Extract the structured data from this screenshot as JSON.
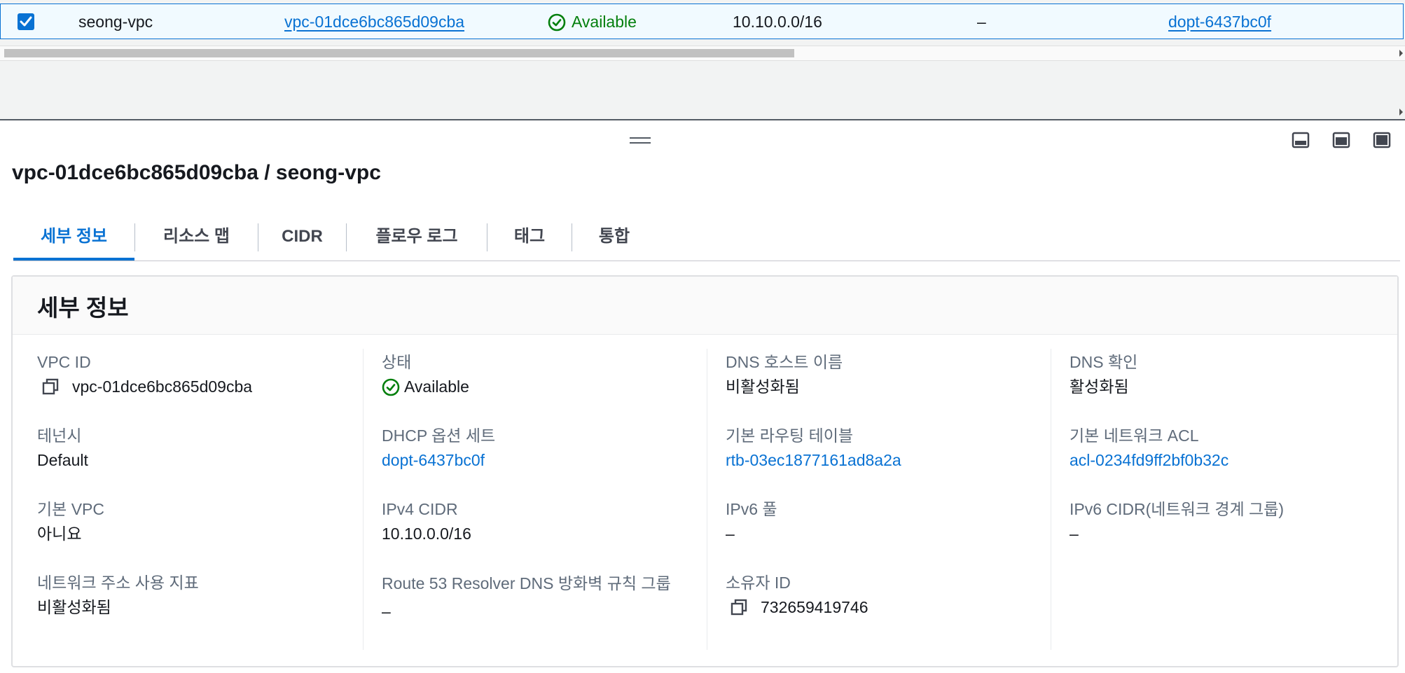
{
  "table_row": {
    "name": "seong-vpc",
    "vpc_id": "vpc-01dce6bc865d09cba",
    "state": "Available",
    "ipv4_cidr": "10.10.0.0/16",
    "ipv6_cidr": "–",
    "dhcp_options": "dopt-6437bc0f"
  },
  "panel": {
    "title": "vpc-01dce6bc865d09cba / seong-vpc"
  },
  "tabs": [
    {
      "label": "세부 정보"
    },
    {
      "label": "리소스 맵"
    },
    {
      "label": "CIDR"
    },
    {
      "label": "플로우 로그"
    },
    {
      "label": "태그"
    },
    {
      "label": "통합"
    }
  ],
  "details": {
    "title": "세부 정보",
    "vpc_id": {
      "label": "VPC ID",
      "value": "vpc-01dce6bc865d09cba"
    },
    "tenancy": {
      "label": "테넌시",
      "value": "Default"
    },
    "default_vpc": {
      "label": "기본 VPC",
      "value": "아니요"
    },
    "network_metrics": {
      "label": "네트워크 주소 사용 지표",
      "value": "비활성화됨"
    },
    "state": {
      "label": "상태",
      "value": "Available"
    },
    "dhcp_options": {
      "label": "DHCP 옵션 세트",
      "value": "dopt-6437bc0f"
    },
    "ipv4_cidr": {
      "label": "IPv4 CIDR",
      "value": "10.10.0.0/16"
    },
    "route53_firewall": {
      "label": "Route 53 Resolver DNS 방화벽 규칙 그룹",
      "value": "–"
    },
    "dns_hostnames": {
      "label": "DNS 호스트 이름",
      "value": "비활성화됨"
    },
    "main_route_table": {
      "label": "기본 라우팅 테이블",
      "value": "rtb-03ec1877161ad8a2a"
    },
    "ipv6_pool": {
      "label": "IPv6 풀",
      "value": "–"
    },
    "owner_id": {
      "label": "소유자 ID",
      "value": "732659419746"
    },
    "dns_resolution": {
      "label": "DNS 확인",
      "value": "활성화됨"
    },
    "main_network_acl": {
      "label": "기본 네트워크 ACL",
      "value": "acl-0234fd9ff2bf0b32c"
    },
    "ipv6_cidr": {
      "label": "IPv6 CIDR(네트워크 경계 그룹)",
      "value": "–"
    }
  },
  "colors": {
    "link": "#0972d3",
    "success": "#037f0c",
    "label": "#5f6b7a",
    "selected_row_bg": "#f1faff"
  },
  "icons": {
    "checkbox": "checkbox-checked-icon",
    "status": "status-positive-icon",
    "copy": "copy-icon",
    "drag": "drag-handle-icon",
    "layouts": [
      "panel-bottom-icon",
      "panel-side-icon",
      "panel-full-icon"
    ]
  }
}
